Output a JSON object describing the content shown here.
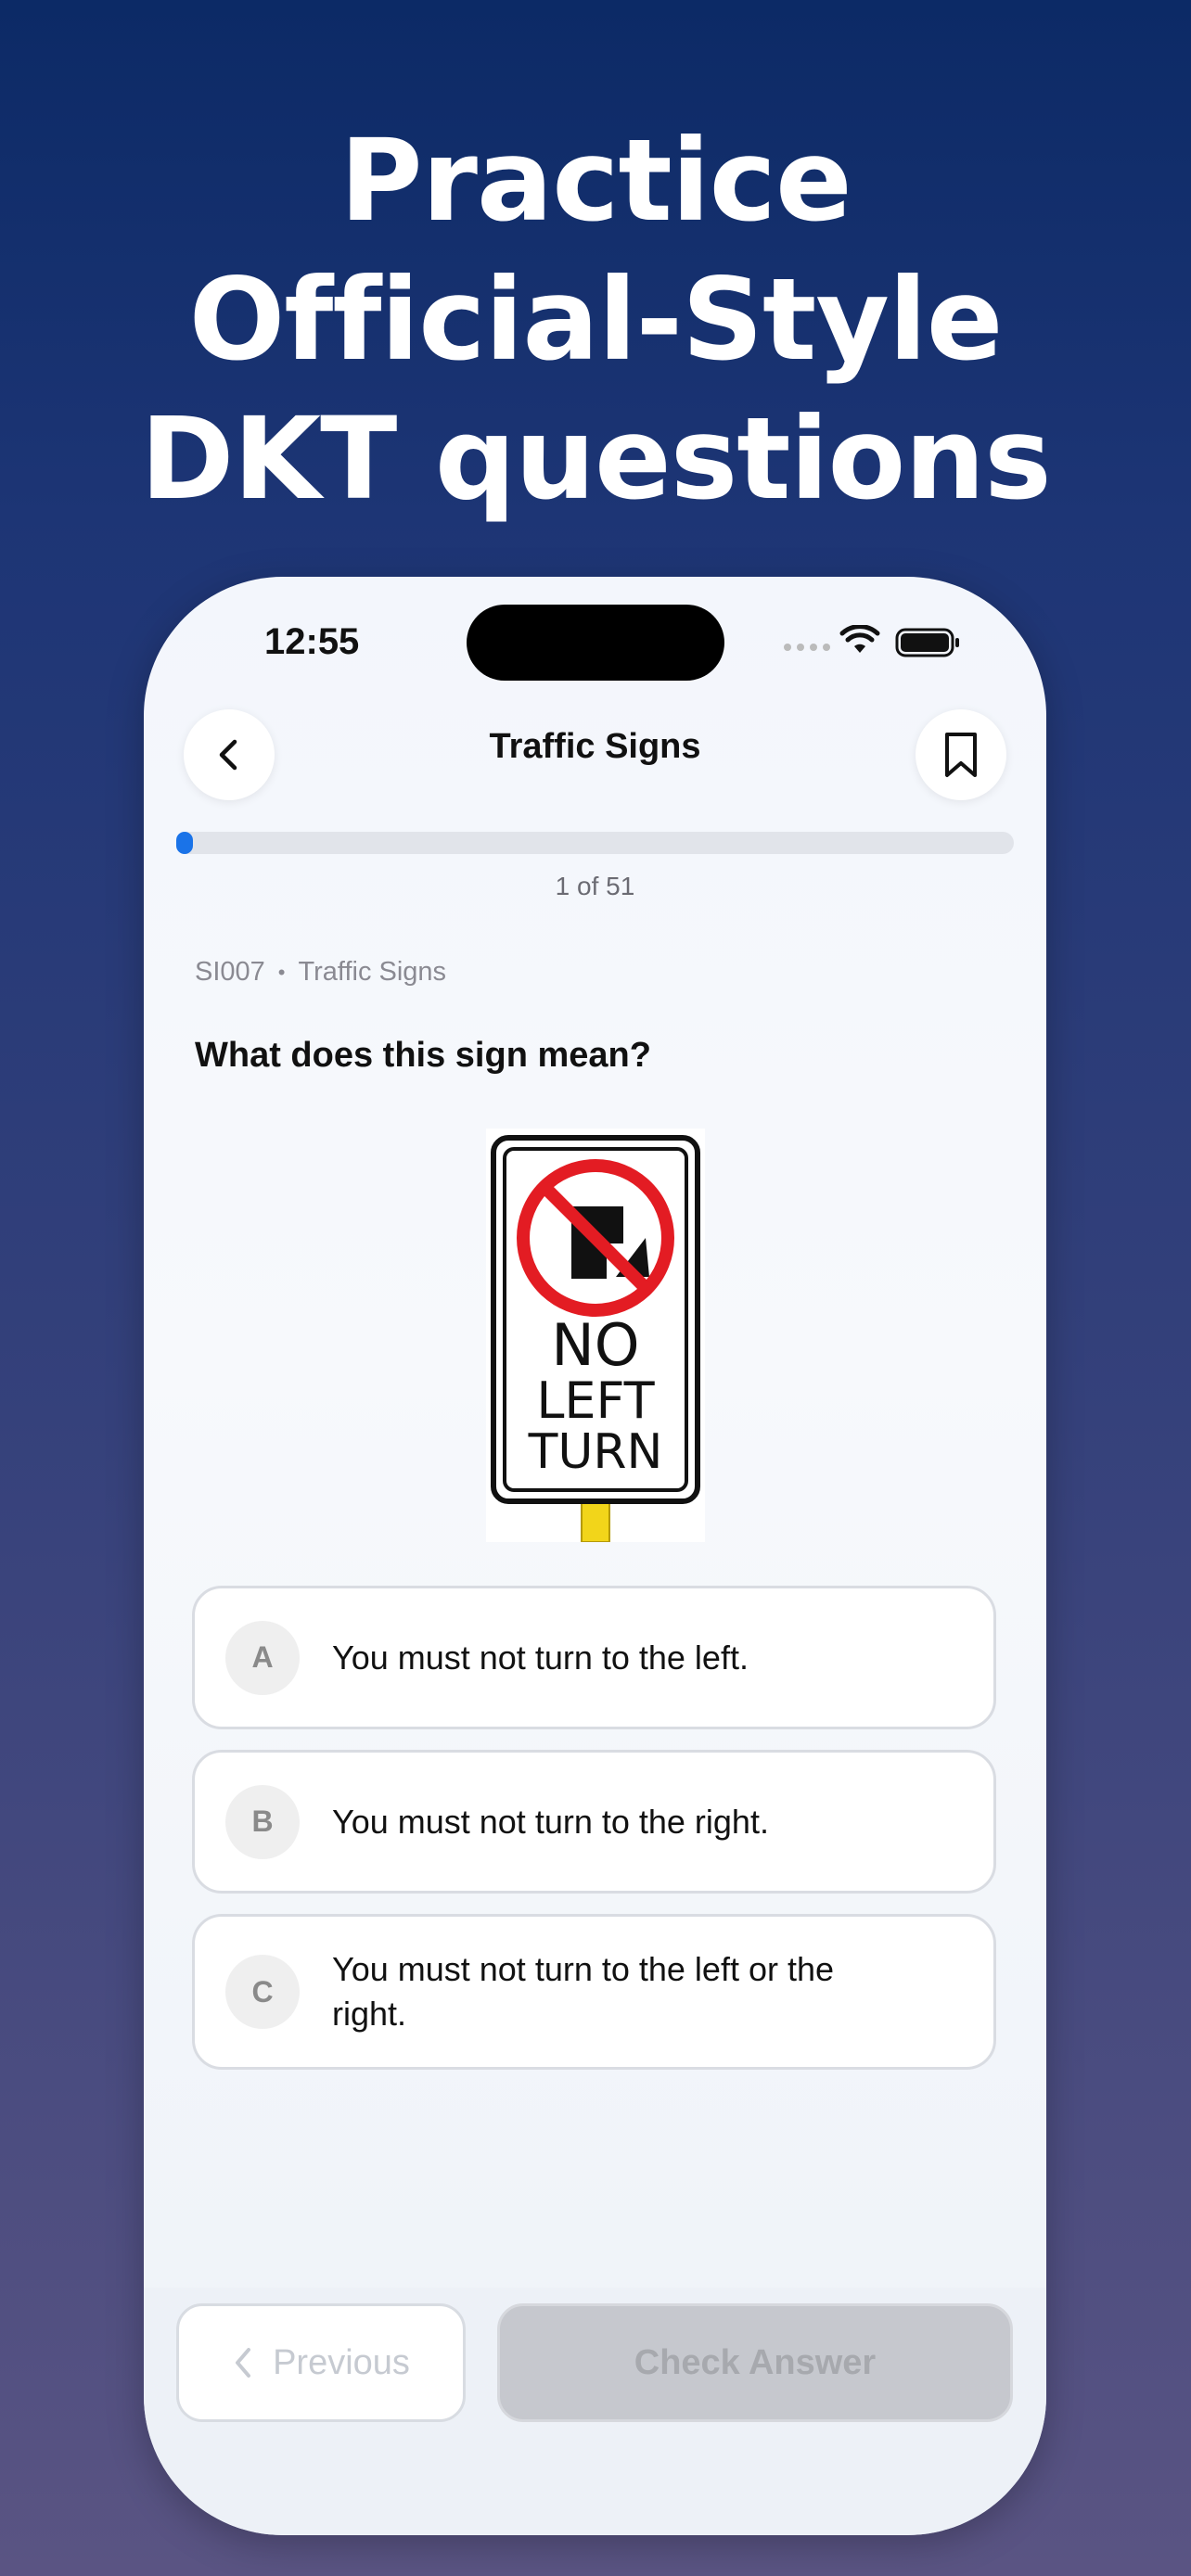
{
  "headline": {
    "line1": "Practice",
    "line2": "Official-Style",
    "line3": "DKT questions"
  },
  "status_bar": {
    "time": "12:55"
  },
  "nav": {
    "title": "Traffic Signs",
    "back_icon": "chevron-left-icon",
    "bookmark_icon": "bookmark-icon"
  },
  "progress": {
    "current": 1,
    "total": 51,
    "label": "1 of 51",
    "fraction": 0.0196
  },
  "question": {
    "code": "SI007",
    "separator": "•",
    "category": "Traffic Signs",
    "text": "What does this sign mean?",
    "sign": {
      "line1": "NO",
      "line2": "LEFT",
      "line3": "TURN"
    }
  },
  "options": [
    {
      "letter": "A",
      "text": "You must not turn to the left."
    },
    {
      "letter": "B",
      "text": "You must not turn to the right."
    },
    {
      "letter": "C",
      "text": "You must not turn to the left or the right."
    }
  ],
  "footer": {
    "previous_label": "Previous",
    "check_label": "Check Answer"
  },
  "colors": {
    "accent": "#1a73e8",
    "background_top": "#0c2a66",
    "background_bottom": "#5a5483"
  }
}
